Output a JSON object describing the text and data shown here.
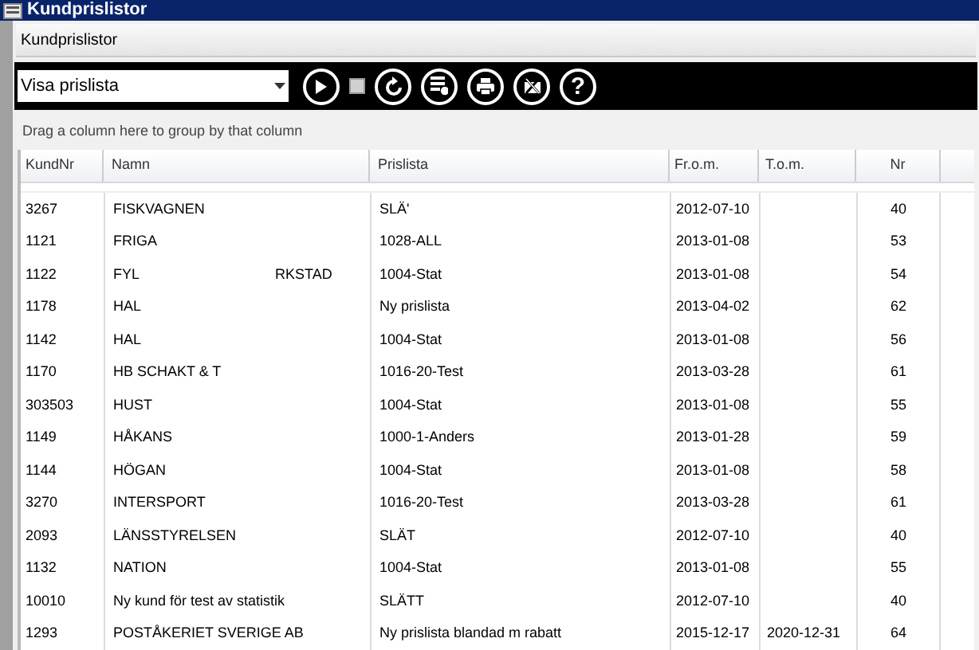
{
  "window": {
    "title": "Kundprislistor"
  },
  "panel": {
    "title": "Kundprislistor"
  },
  "toolbar": {
    "dropdown": {
      "value": "Visa prislista"
    },
    "buttons": [
      {
        "kind": "play"
      },
      {
        "kind": "stop"
      },
      {
        "kind": "refresh"
      },
      {
        "kind": "list-remove"
      },
      {
        "kind": "print"
      },
      {
        "kind": "excel"
      },
      {
        "kind": "help",
        "label": "?"
      }
    ]
  },
  "group_panel": {
    "hint": "Drag a column here to group by that column"
  },
  "table": {
    "columns": [
      "KundNr",
      "Namn",
      "Prislista",
      "Fr.o.m.",
      "T.o.m.",
      "Nr"
    ],
    "rows": [
      {
        "cells": [
          "3267",
          "FISKVAGNEN",
          "SLÄ'",
          "2012-07-10",
          "",
          "40"
        ]
      },
      {
        "cells": [
          "1121",
          "FRIGA",
          "1028-ALL",
          "2013-01-08",
          "",
          "53"
        ]
      },
      {
        "cells": [
          "1122",
          "FYL",
          "1004-Stat",
          "2013-01-08",
          "",
          "54"
        ],
        "name_tail": "RKSTAD"
      },
      {
        "cells": [
          "1178",
          "HAL",
          "Ny prislista",
          "2013-04-02",
          "",
          "62"
        ]
      },
      {
        "cells": [
          "1142",
          "HAL",
          "1004-Stat",
          "2013-01-08",
          "",
          "56"
        ]
      },
      {
        "cells": [
          "1170",
          "HB SCHAKT & T",
          "1016-20-Test",
          "2013-03-28",
          "",
          "61"
        ]
      },
      {
        "cells": [
          "303503",
          "HUST",
          "1004-Stat",
          "2013-01-08",
          "",
          "55"
        ]
      },
      {
        "cells": [
          "1149",
          "HÅKANS",
          "1000-1-Anders",
          "2013-01-28",
          "",
          "59"
        ]
      },
      {
        "cells": [
          "1144",
          "HÖGAN",
          "1004-Stat",
          "2013-01-08",
          "",
          "58"
        ]
      },
      {
        "cells": [
          "3270",
          "INTERSPORT",
          "1016-20-Test",
          "2013-03-28",
          "",
          "61"
        ]
      },
      {
        "cells": [
          "2093",
          "LÄNSSTYRELSEN",
          "SLÄT",
          "2012-07-10",
          "",
          "40"
        ]
      },
      {
        "cells": [
          "1132",
          "NATION",
          "1004-Stat",
          "2013-01-08",
          "",
          "55"
        ]
      },
      {
        "cells": [
          "10010",
          "Ny kund för test av statistik",
          "SLÄTT",
          "2012-07-10",
          "",
          "40"
        ]
      },
      {
        "cells": [
          "1293",
          "POSTÅKERIET SVERIGE AB",
          "Ny prislista blandad m rabatt",
          "2015-12-17",
          "2020-12-31",
          "64"
        ]
      }
    ]
  }
}
